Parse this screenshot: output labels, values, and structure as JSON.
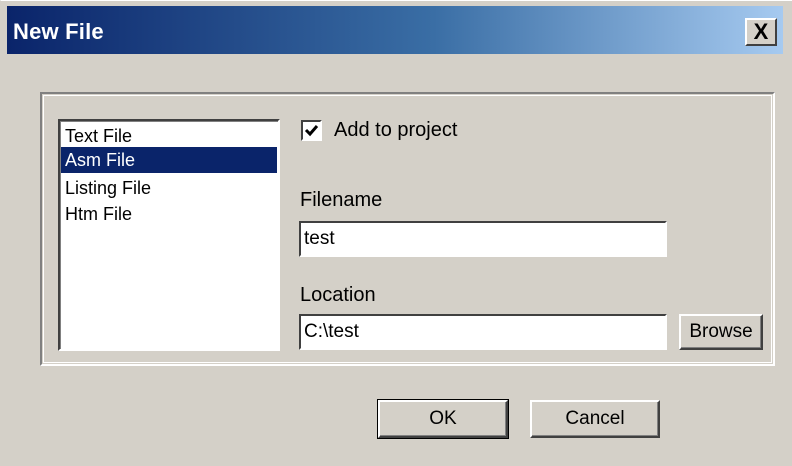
{
  "window": {
    "title": "New File",
    "close_glyph": "X"
  },
  "file_types": [
    {
      "label": "Text File",
      "selected": false
    },
    {
      "label": "Asm File",
      "selected": true
    },
    {
      "label": "Listing File",
      "selected": false
    },
    {
      "label": "Htm File",
      "selected": false
    }
  ],
  "options": {
    "add_to_project_label": "Add to project",
    "add_to_project_checked": true
  },
  "filename": {
    "label": "Filename",
    "value": "test"
  },
  "location": {
    "label": "Location",
    "value": "C:\\test",
    "browse_label": "Browse"
  },
  "buttons": {
    "ok": "OK",
    "cancel": "Cancel"
  },
  "colors": {
    "face": "#d4d0c8",
    "selection": "#0a246a",
    "title_gradient_start": "#0a246a",
    "title_gradient_end": "#a6caf0"
  }
}
